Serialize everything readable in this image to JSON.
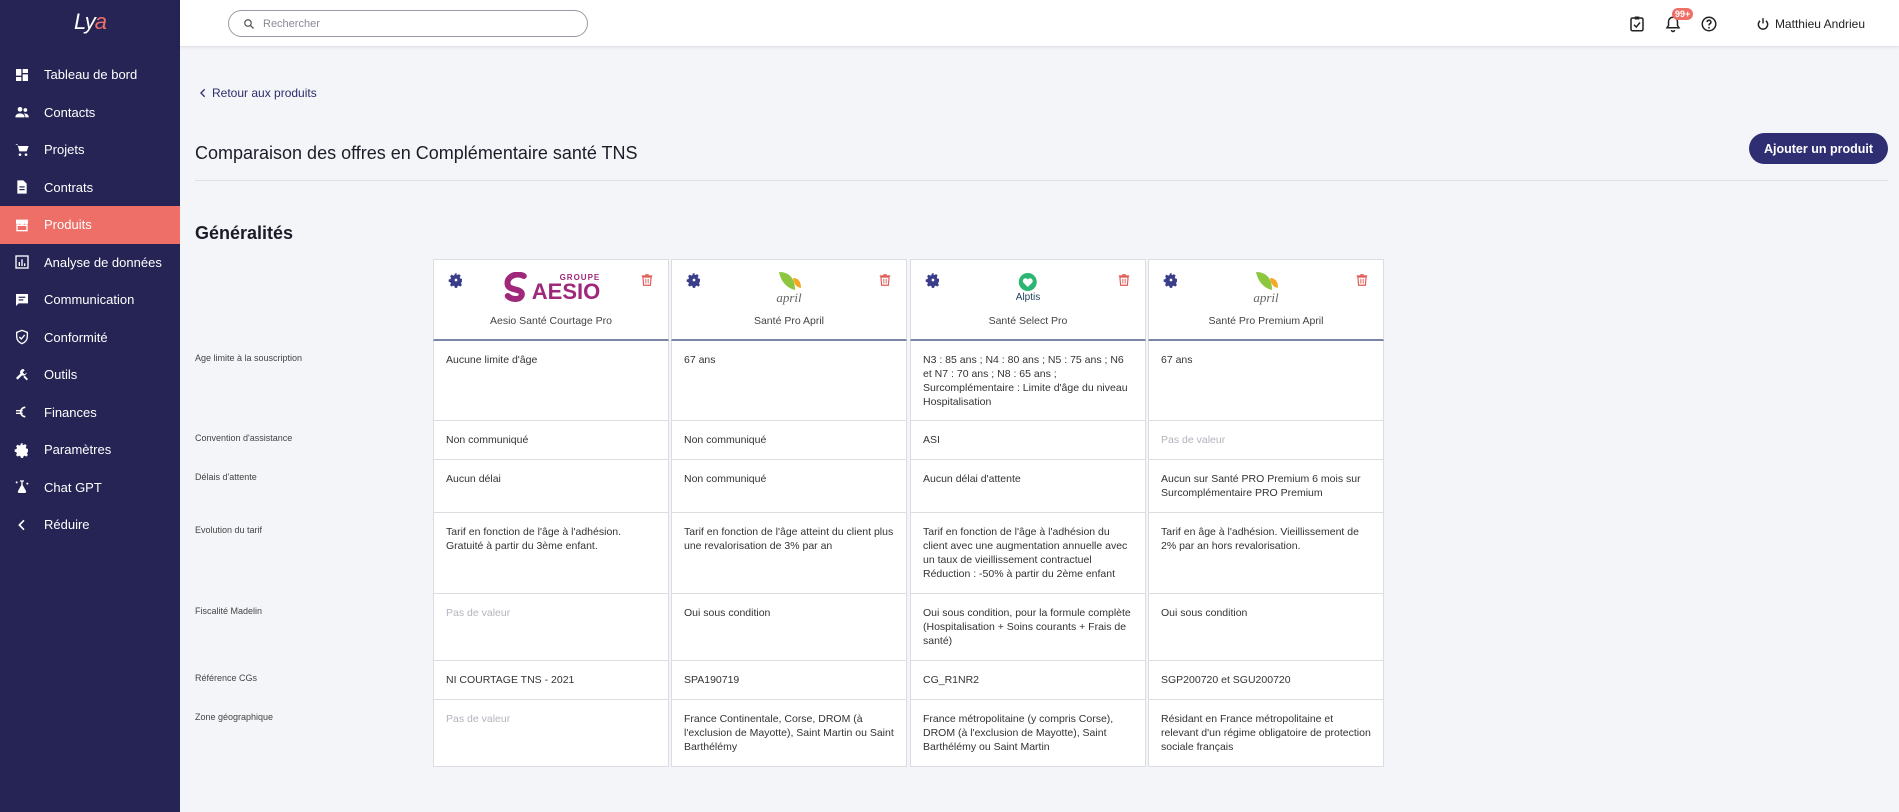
{
  "app": {
    "logo_main": "Ly",
    "logo_accent": "a"
  },
  "sidebar": {
    "items": [
      {
        "label": "Tableau de bord",
        "icon": "dashboard-icon"
      },
      {
        "label": "Contacts",
        "icon": "contacts-icon"
      },
      {
        "label": "Projets",
        "icon": "cart-icon"
      },
      {
        "label": "Contrats",
        "icon": "document-icon"
      },
      {
        "label": "Produits",
        "icon": "store-icon",
        "active": true
      },
      {
        "label": "Analyse de données",
        "icon": "chart-icon"
      },
      {
        "label": "Communication",
        "icon": "message-icon"
      },
      {
        "label": "Conformité",
        "icon": "shield-icon"
      },
      {
        "label": "Outils",
        "icon": "tools-icon"
      },
      {
        "label": "Finances",
        "icon": "euro-icon"
      },
      {
        "label": "Paramètres",
        "icon": "gear-icon"
      },
      {
        "label": "Chat GPT",
        "icon": "chat-gpt-icon"
      },
      {
        "label": "Réduire",
        "icon": "chevron-left-icon"
      }
    ]
  },
  "topbar": {
    "search_placeholder": "Rechercher",
    "notification_badge": "99+",
    "user_name": "Matthieu Andrieu"
  },
  "main": {
    "back_label": "Retour aux produits",
    "title": "Comparaison des offres en Complémentaire santé TNS",
    "add_button": "Ajouter un produit",
    "section_title": "Généralités"
  },
  "products": [
    {
      "name": "Aesio Santé Courtage Pro",
      "logo": "GROUPE AESIO",
      "logo_top": "GROUPE",
      "logo_main": "AESIO"
    },
    {
      "name": "Santé Pro April",
      "logo": "april",
      "logo_main": "april"
    },
    {
      "name": "Santé Select Pro",
      "logo": "Alptis",
      "logo_main": "Alptis"
    },
    {
      "name": "Santé Pro Premium April",
      "logo": "april",
      "logo_main": "april"
    }
  ],
  "rows": [
    {
      "label": "Age limite à la souscription",
      "values": [
        "Aucune limite d'âge",
        "67 ans",
        "N3 : 85 ans ; N4 : 80 ans ; N5 : 75 ans ; N6 et N7 : 70 ans ; N8 : 65 ans ; Surcomplémentaire : Limite d'âge du niveau Hospitalisation",
        "67 ans"
      ]
    },
    {
      "label": "Convention d'assistance",
      "values": [
        "Non communiqué",
        "Non communiqué",
        "ASI",
        "Pas de valeur"
      ]
    },
    {
      "label": "Délais d'attente",
      "values": [
        "Aucun délai",
        "Non communiqué",
        "Aucun délai d'attente",
        "Aucun sur Santé PRO Premium 6 mois sur Surcomplémentaire PRO Premium"
      ]
    },
    {
      "label": "Evolution du tarif",
      "values": [
        "Tarif en fonction de l'âge à l'adhésion. Gratuité à partir du 3ème enfant.",
        "Tarif en fonction de l'âge atteint du client plus une revalorisation de 3% par an",
        "Tarif en fonction de l'âge à l'adhésion du client avec une augmentation annuelle avec un taux de vieillissement contractuel Réduction : -50% à partir du 2ème enfant",
        "Tarif en âge à l'adhésion. Vieillissement de 2% par an hors revalorisation."
      ]
    },
    {
      "label": "Fiscalité Madelin",
      "values": [
        "Pas de valeur",
        "Oui sous condition",
        "Oui sous condition, pour la formule complète (Hospitalisation + Soins courants + Frais de santé)",
        "Oui sous condition"
      ]
    },
    {
      "label": "Référence CGs",
      "values": [
        "NI COURTAGE TNS - 2021",
        "SPA190719",
        "CG_R1NR2",
        "SGP200720 et SGU200720"
      ]
    },
    {
      "label": "Zone géographique",
      "values": [
        "Pas de valeur",
        "France Continentale, Corse, DROM (à l'exclusion de Mayotte), Saint Martin ou Saint Barthélémy",
        "France métropolitaine (y compris Corse), DROM (à l'exclusion de Mayotte), Saint Barthélémy ou Saint Martin",
        "Résidant en France métropolitaine et relevant d'un régime obligatoire de protection sociale français"
      ]
    }
  ],
  "colors": {
    "sidebar": "#252454",
    "active": "#ee6f67",
    "primary": "#302e73"
  }
}
